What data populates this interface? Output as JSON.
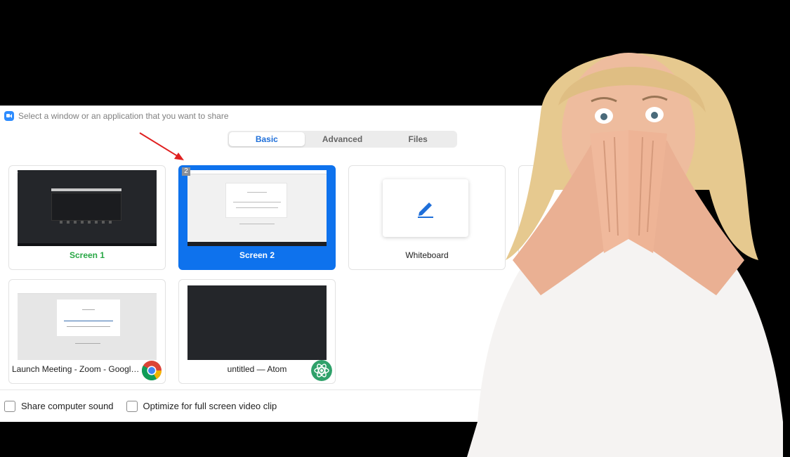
{
  "dialog": {
    "title": "Select a window or an application that you want to share"
  },
  "tabs": [
    {
      "label": "Basic",
      "active": true
    },
    {
      "label": "Advanced",
      "active": false
    },
    {
      "label": "Files",
      "active": false
    }
  ],
  "sources": [
    {
      "label": "Screen 1",
      "number": "1",
      "selected": false
    },
    {
      "label": "Screen 2",
      "number": "2",
      "selected": true
    },
    {
      "label": "Whiteboard",
      "selected": false
    },
    {
      "label": "Launch Meeting - Zoom - Google Chrome",
      "app": "chrome-icon"
    },
    {
      "label": "untitled — Atom",
      "app": "atom-icon"
    }
  ],
  "options": {
    "share_sound": "Share computer sound",
    "optimize_video": "Optimize for full screen video clip"
  },
  "colors": {
    "accent": "#0e72ed",
    "screen1_label": "#28a745"
  }
}
